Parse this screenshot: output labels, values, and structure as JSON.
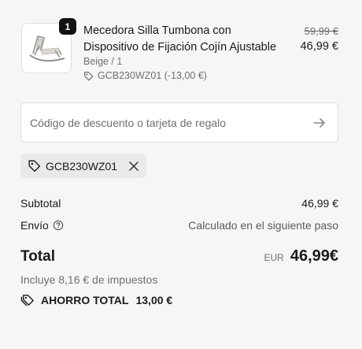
{
  "line_item": {
    "quantity": "1",
    "title": "Mecedora Silla Tumbona con Dispositivo de Fijación Cojín Ajustable",
    "variant": "Beige / 1",
    "discount": "GCB230WZ01 (-13,00 €)",
    "compare_price": "59,99 €",
    "price": "46,99 €",
    "thumbnail_icon": "rocking-lounge-chair-image"
  },
  "discount_form": {
    "placeholder": "Código de descuento o tarjeta de regalo",
    "value": "",
    "submit_icon": "arrow-right-icon"
  },
  "applied_code": {
    "code": "GCB230WZ01",
    "tag_icon": "tag-icon",
    "remove_icon": "close-icon"
  },
  "summary": {
    "subtotal_label": "Subtotal",
    "subtotal_value": "46,99 €",
    "shipping_label": "Envío",
    "shipping_value": "Calculado en el siguiente paso",
    "shipping_help_icon": "question-circle-icon",
    "total_label": "Total",
    "currency": "EUR",
    "total_value": "46,99€",
    "taxes_note": "Incluye 8,16 € de impuestos",
    "savings_label": "AHORRO TOTAL",
    "savings_value": "13,00 €",
    "savings_icon": "tags-icon"
  },
  "colors": {
    "background": "#f6f6f6",
    "text": "#1a1a1a",
    "muted": "#707070",
    "badge": "#111111",
    "chip_bg": "#e9e9e9"
  }
}
